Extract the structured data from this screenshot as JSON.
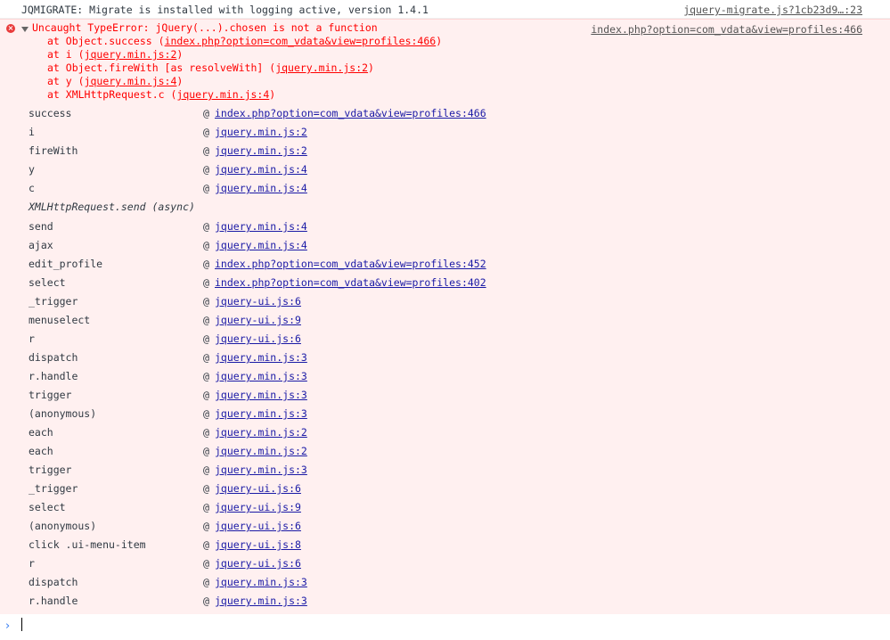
{
  "migrate_log": {
    "message": "JQMIGRATE: Migrate is installed with logging active, version 1.4.1",
    "source": "jquery-migrate.js?1cb23d9…:23"
  },
  "error": {
    "source": "index.php?option=com_vdata&view=profiles:466",
    "header_prefix": "Uncaught TypeError: ",
    "header_message": "jQuery(...).chosen is not a function",
    "stack_lines": [
      {
        "prefix": "at Object.success (",
        "link": "index.php?option=com_vdata&view=profiles:466",
        "suffix": ")"
      },
      {
        "prefix": "at i (",
        "link": "jquery.min.js:2",
        "suffix": ")"
      },
      {
        "prefix": "at Object.fireWith [as resolveWith] (",
        "link": "jquery.min.js:2",
        "suffix": ")"
      },
      {
        "prefix": "at y (",
        "link": "jquery.min.js:4",
        "suffix": ")"
      },
      {
        "prefix": "at XMLHttpRequest.c (",
        "link": "jquery.min.js:4",
        "suffix": ")"
      }
    ],
    "frames_a": [
      {
        "fn": "success",
        "at": "@",
        "loc": "index.php?option=com_vdata&view=profiles:466"
      },
      {
        "fn": "i",
        "at": "@",
        "loc": "jquery.min.js:2"
      },
      {
        "fn": "fireWith",
        "at": "@",
        "loc": "jquery.min.js:2"
      },
      {
        "fn": "y",
        "at": "@",
        "loc": "jquery.min.js:4"
      },
      {
        "fn": "c",
        "at": "@",
        "loc": "jquery.min.js:4"
      }
    ],
    "async_label": "XMLHttpRequest.send (async)",
    "frames_b": [
      {
        "fn": "send",
        "at": "@",
        "loc": "jquery.min.js:4"
      },
      {
        "fn": "ajax",
        "at": "@",
        "loc": "jquery.min.js:4"
      },
      {
        "fn": "edit_profile",
        "at": "@",
        "loc": "index.php?option=com_vdata&view=profiles:452"
      },
      {
        "fn": "select",
        "at": "@",
        "loc": "index.php?option=com_vdata&view=profiles:402"
      },
      {
        "fn": "_trigger",
        "at": "@",
        "loc": "jquery-ui.js:6"
      },
      {
        "fn": "menuselect",
        "at": "@",
        "loc": "jquery-ui.js:9"
      },
      {
        "fn": "r",
        "at": "@",
        "loc": "jquery-ui.js:6"
      },
      {
        "fn": "dispatch",
        "at": "@",
        "loc": "jquery.min.js:3"
      },
      {
        "fn": "r.handle",
        "at": "@",
        "loc": "jquery.min.js:3"
      },
      {
        "fn": "trigger",
        "at": "@",
        "loc": "jquery.min.js:3"
      },
      {
        "fn": "(anonymous)",
        "at": "@",
        "loc": "jquery.min.js:3"
      },
      {
        "fn": "each",
        "at": "@",
        "loc": "jquery.min.js:2"
      },
      {
        "fn": "each",
        "at": "@",
        "loc": "jquery.min.js:2"
      },
      {
        "fn": "trigger",
        "at": "@",
        "loc": "jquery.min.js:3"
      },
      {
        "fn": "_trigger",
        "at": "@",
        "loc": "jquery-ui.js:6"
      },
      {
        "fn": "select",
        "at": "@",
        "loc": "jquery-ui.js:9"
      },
      {
        "fn": "(anonymous)",
        "at": "@",
        "loc": "jquery-ui.js:6"
      },
      {
        "fn": "click .ui-menu-item",
        "at": "@",
        "loc": "jquery-ui.js:8"
      },
      {
        "fn": "r",
        "at": "@",
        "loc": "jquery-ui.js:6"
      },
      {
        "fn": "dispatch",
        "at": "@",
        "loc": "jquery.min.js:3"
      },
      {
        "fn": "r.handle",
        "at": "@",
        "loc": "jquery.min.js:3"
      }
    ]
  },
  "prompt": {
    "symbol": "›",
    "value": ""
  }
}
